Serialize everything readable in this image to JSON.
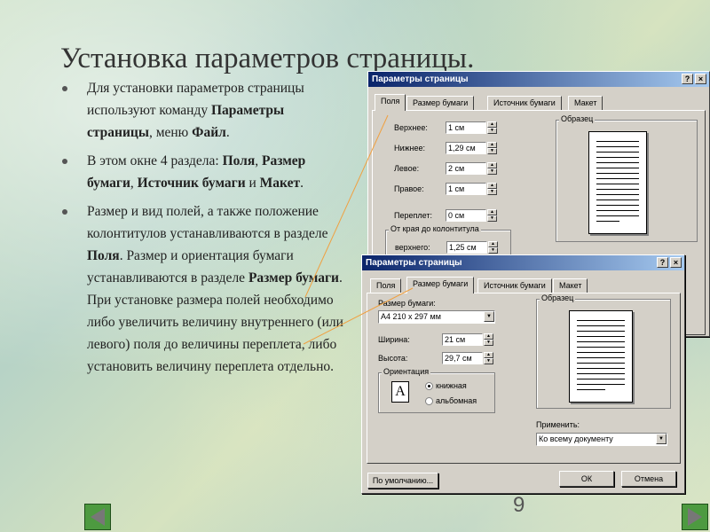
{
  "slide": {
    "title": "Установка параметров страницы.",
    "page_number": "9",
    "bullets": [
      [
        {
          "t": "Для установки параметров страницы используют команду ",
          "b": false
        },
        {
          "t": "Параметры страницы",
          "b": true
        },
        {
          "t": ", меню ",
          "b": false
        },
        {
          "t": "Файл",
          "b": true
        },
        {
          "t": ".",
          "b": false
        }
      ],
      [
        {
          "t": "В этом окне 4 раздела: ",
          "b": false
        },
        {
          "t": "Поля",
          "b": true
        },
        {
          "t": ", ",
          "b": false
        },
        {
          "t": "Размер бумаги",
          "b": true
        },
        {
          "t": ", ",
          "b": false
        },
        {
          "t": "Источник бумаги",
          "b": true
        },
        {
          "t": " и ",
          "b": false
        },
        {
          "t": "Макет",
          "b": true
        },
        {
          "t": ".",
          "b": false
        }
      ],
      [
        {
          "t": "Размер и вид полей, а также положение колонтитулов устанавливаются в разделе ",
          "b": false
        },
        {
          "t": "Поля",
          "b": true
        },
        {
          "t": ". Размер и ориентация бумаги устанавливаются в разделе ",
          "b": false
        },
        {
          "t": "Размер бумаги",
          "b": true
        },
        {
          "t": ". При установке размера полей необходимо либо увеличить величину внутреннего (или левого) поля до величины переплета, либо установить величину переплета отдельно.",
          "b": false
        }
      ]
    ],
    "nav": {
      "prev_icon": "arrow-left-icon",
      "next_icon": "arrow-right-icon",
      "color": "#4d9a40"
    }
  },
  "dialog1": {
    "title": "Параметры страницы",
    "help_button": "?",
    "close_button": "×",
    "tabs": [
      "Поля",
      "Размер бумаги",
      "Источник бумаги",
      "Макет"
    ],
    "fields": [
      {
        "label": "Верхнее:",
        "value": "1 см"
      },
      {
        "label": "Нижнее:",
        "value": "1,29 см"
      },
      {
        "label": "Левое:",
        "value": "2 см"
      },
      {
        "label": "Правое:",
        "value": "1 см"
      },
      {
        "label": "Переплет:",
        "value": "0 см"
      }
    ],
    "header_group": "От края до колонтитула",
    "header_field": {
      "label": "верхнего:",
      "value": "1,25 см"
    },
    "preview_label": "Образец"
  },
  "dialog2": {
    "title": "Параметры страницы",
    "help_button": "?",
    "close_button": "×",
    "tabs": [
      "Поля",
      "Размер бумаги",
      "Источник бумаги",
      "Макет"
    ],
    "paper_size_label": "Размер бумаги:",
    "paper_size_value": "A4 210 x 297 мм",
    "width": {
      "label": "Ширина:",
      "value": "21 см"
    },
    "height": {
      "label": "Высота:",
      "value": "29,7 см"
    },
    "orientation_label": "Ориентация",
    "orientation_icon": "A",
    "portrait": "книжная",
    "landscape": "альбомная",
    "preview_label": "Образец",
    "apply_label": "Применить:",
    "apply_value": "Ко всему документу",
    "default_button": "По умолчанию...",
    "ok_button": "ОК",
    "cancel_button": "Отмена"
  },
  "colors": {
    "title_bar": "#0a246a",
    "dialog_bg": "#d4d0c8",
    "pointer_arrow": "#f0a040"
  }
}
